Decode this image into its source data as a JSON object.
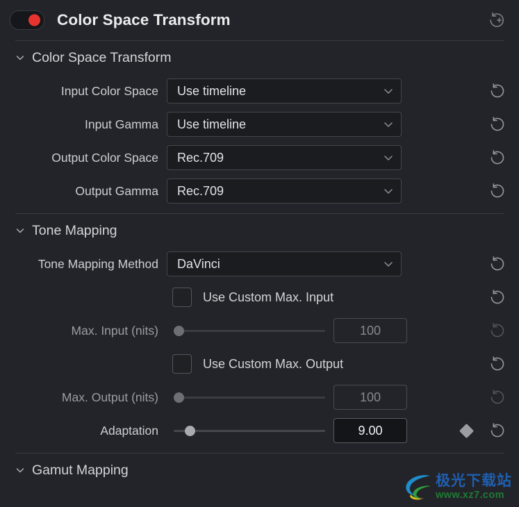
{
  "header": {
    "title": "Color Space Transform",
    "power_toggle_state": "on",
    "power_toggle_color": "#e8342f",
    "reset_all_icon": "reset-add-icon"
  },
  "sections": [
    {
      "id": "color-space-transform",
      "title": "Color Space Transform",
      "expanded": true,
      "chevron_icon": "chevron-down-icon",
      "rows": [
        {
          "label": "Input Color Space",
          "type": "dropdown",
          "value": "Use timeline",
          "enabled": true,
          "reset_icon": "reset-icon"
        },
        {
          "label": "Input Gamma",
          "type": "dropdown",
          "value": "Use timeline",
          "enabled": true,
          "reset_icon": "reset-icon"
        },
        {
          "label": "Output Color Space",
          "type": "dropdown",
          "value": "Rec.709",
          "enabled": true,
          "reset_icon": "reset-icon"
        },
        {
          "label": "Output Gamma",
          "type": "dropdown",
          "value": "Rec.709",
          "enabled": true,
          "reset_icon": "reset-icon"
        }
      ]
    },
    {
      "id": "tone-mapping",
      "title": "Tone Mapping",
      "expanded": true,
      "chevron_icon": "chevron-down-icon",
      "rows": [
        {
          "label": "Tone Mapping Method",
          "type": "dropdown",
          "value": "DaVinci",
          "enabled": true,
          "reset_icon": "reset-icon"
        },
        {
          "label": "",
          "type": "checkbox",
          "checkbox_label": "Use Custom Max. Input",
          "checked": false,
          "enabled": true,
          "reset_icon": "reset-icon"
        },
        {
          "label": "Max. Input (nits)",
          "type": "slider",
          "value": "100",
          "slider_percent": 0,
          "enabled": false,
          "reset_icon": "reset-icon"
        },
        {
          "label": "",
          "type": "checkbox",
          "checkbox_label": "Use Custom Max. Output",
          "checked": false,
          "enabled": true,
          "reset_icon": "reset-icon"
        },
        {
          "label": "Max. Output (nits)",
          "type": "slider",
          "value": "100",
          "slider_percent": 0,
          "enabled": false,
          "reset_icon": "reset-icon"
        },
        {
          "label": "Adaptation",
          "type": "slider",
          "value": "9.00",
          "slider_percent": 8,
          "enabled": true,
          "keyframe_icon": "keyframe-diamond-icon",
          "reset_icon": "reset-icon"
        }
      ]
    },
    {
      "id": "gamut-mapping",
      "title": "Gamut Mapping",
      "expanded": true,
      "chevron_icon": "chevron-down-icon",
      "rows": []
    }
  ],
  "watermark": {
    "brand_cn": "极光下载站",
    "url": "www.xz7.com"
  }
}
